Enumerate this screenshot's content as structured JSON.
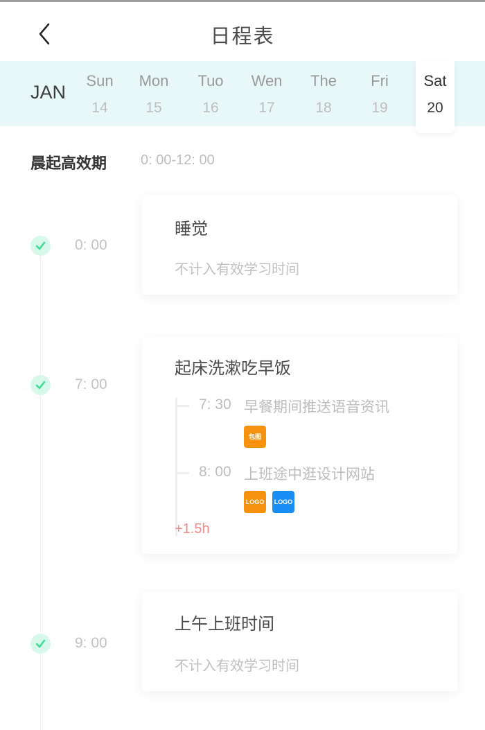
{
  "header": {
    "back_icon": "chevron-left-icon",
    "title": "日程表"
  },
  "week": {
    "month": "JAN",
    "days": [
      {
        "name": "Sun",
        "date": "14",
        "active": false
      },
      {
        "name": "Mon",
        "date": "15",
        "active": false
      },
      {
        "name": "Tuo",
        "date": "16",
        "active": false
      },
      {
        "name": "Wen",
        "date": "17",
        "active": false
      },
      {
        "name": "The",
        "date": "18",
        "active": false
      },
      {
        "name": "Fri",
        "date": "19",
        "active": false
      },
      {
        "name": "Sat",
        "date": "20",
        "active": true
      }
    ]
  },
  "section": {
    "title": "晨起高效期",
    "range": "0: 00-12: 00"
  },
  "schedule": [
    {
      "time": "0: 00",
      "status_icon": "check-icon",
      "title": "睡觉",
      "subtitle": "不计入有效学习时间"
    },
    {
      "time": "7: 00",
      "status_icon": "check-icon",
      "title": "起床洗漱吃早饭",
      "subitems": [
        {
          "time": "7: 30",
          "text": "早餐期间推送语音资讯",
          "tags": [
            {
              "label": "包图",
              "color": "#f7920f"
            }
          ]
        },
        {
          "time": "8: 00",
          "text": "上班途中逛设计网站",
          "tags": [
            {
              "label": "LOGO",
              "color": "#f7920f"
            },
            {
              "label": "LOGO",
              "color": "#1b8ef5"
            }
          ]
        }
      ],
      "extra": "+1.5h"
    },
    {
      "time": "9: 00",
      "status_icon": "check-icon",
      "title": "上午上班时间",
      "subtitle": "不计入有效学习时间"
    }
  ],
  "colors": {
    "week_band": "#e8f7f7",
    "check_bg": "#d9f8ec",
    "check_mark": "#3ddc97",
    "extra_text": "#f28a8a",
    "tag_orange": "#f7920f",
    "tag_blue": "#1b8ef5"
  }
}
